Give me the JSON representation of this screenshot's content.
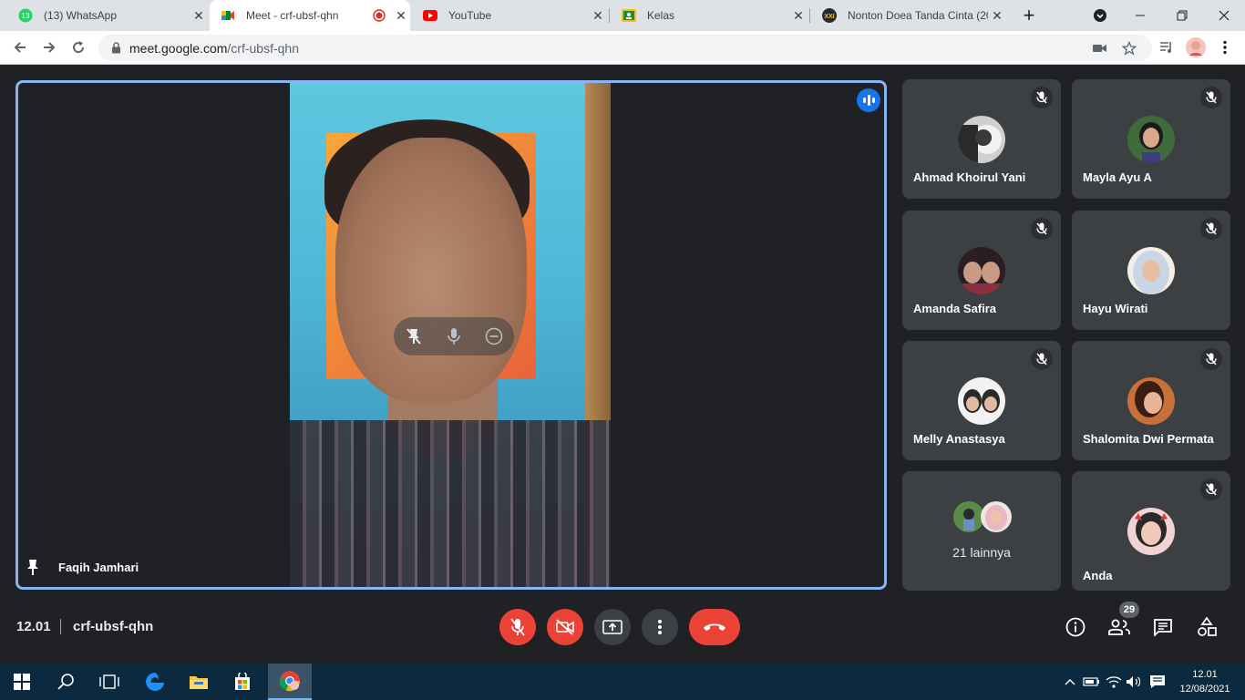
{
  "browser": {
    "tabs": [
      {
        "label": "(13) WhatsApp",
        "favicon_badge": "13",
        "favicon": "whatsapp-icon",
        "active": false
      },
      {
        "label": "Meet - crf-ubsf-qhn",
        "favicon": "google-meet-icon",
        "active": true
      },
      {
        "label": "YouTube",
        "favicon": "youtube-icon",
        "active": false
      },
      {
        "label": "Kelas",
        "favicon": "classroom-icon",
        "active": false
      },
      {
        "label": "Nonton Doea Tanda Cinta (20",
        "favicon": "xxi-icon",
        "active": false
      }
    ],
    "address": {
      "host": "meet.google.com",
      "path": "/crf-ubsf-qhn"
    }
  },
  "meet": {
    "main_speaker": "Faqih Jamhari",
    "participants": [
      {
        "name": "Ahmad Khoirul Yani"
      },
      {
        "name": "Mayla Ayu A"
      },
      {
        "name": "Amanda Safira"
      },
      {
        "name": "Hayu Wirati"
      },
      {
        "name": "Melly Anastasya"
      },
      {
        "name": "Shalomita Dwi Permata"
      },
      {
        "more": "21 lainnya"
      },
      {
        "name": "Anda"
      }
    ],
    "time": "12.01",
    "meeting_code": "crf-ubsf-qhn",
    "people_count": "29"
  },
  "taskbar": {
    "clock_time": "12.01",
    "clock_date": "12/08/2021"
  },
  "colors": {
    "accent_blue": "#8ab4f8",
    "red": "#ea4335",
    "tile_bg": "#3c4043",
    "stage_bg": "#202124"
  }
}
